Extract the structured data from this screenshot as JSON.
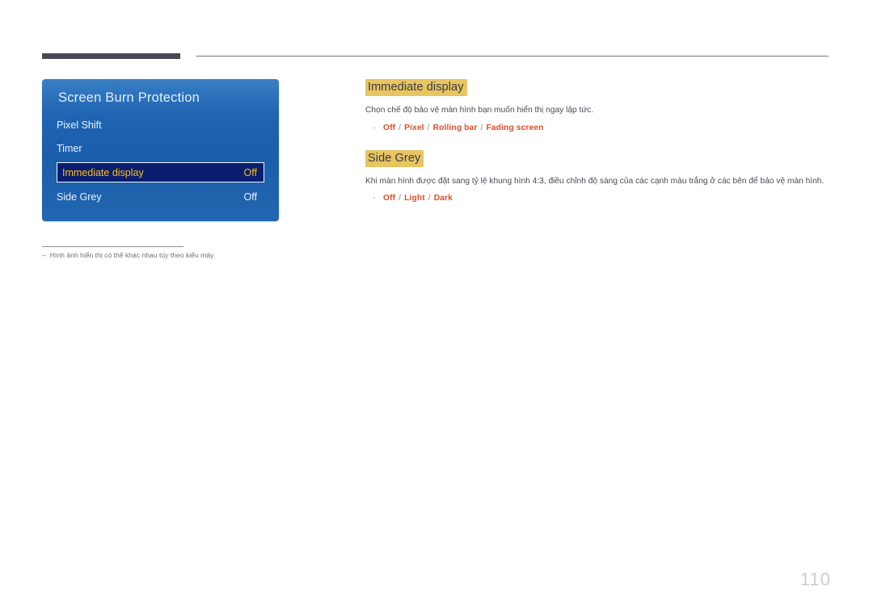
{
  "page": {
    "number": "110"
  },
  "osd": {
    "title": "Screen Burn Protection",
    "items": [
      {
        "label": "Pixel Shift",
        "value": ""
      },
      {
        "label": "Timer",
        "value": ""
      },
      {
        "label": "Immediate display",
        "value": "Off"
      },
      {
        "label": "Side Grey",
        "value": "Off"
      }
    ],
    "selected_index": 2,
    "colors": {
      "panel_blue": "#1b5fac",
      "selected_background": "#0b1d6e",
      "selected_text": "#f3c01c",
      "item_text": "#e9f2fc"
    }
  },
  "footnote": {
    "marker": "‒",
    "text": "Hình ảnh hiển thị có thể khác nhau tùy theo kiểu máy."
  },
  "sections": [
    {
      "heading": "Immediate display",
      "body": "Chọn chế độ bảo vệ màn hình bạn muốn hiển thị ngay lập tức.",
      "bullet_marker": "·",
      "options": [
        "Off",
        "Pixel",
        "Rolling bar",
        "Fading screen"
      ],
      "separator": "/"
    },
    {
      "heading": "Side Grey",
      "body": "Khi màn hình được đặt sang tỷ lệ khung hình 4:3, điều chỉnh độ sáng của các cạnh màu trắng ở các bên để bảo vệ màn hình.",
      "bullet_marker": "·",
      "options": [
        "Off",
        "Light",
        "Dark"
      ],
      "separator": "/"
    }
  ],
  "colors": {
    "heading_highlight": "#e7c562",
    "option_accent": "#d9512a",
    "header_bar": "#474755",
    "page_number": "#c9cfd4"
  }
}
